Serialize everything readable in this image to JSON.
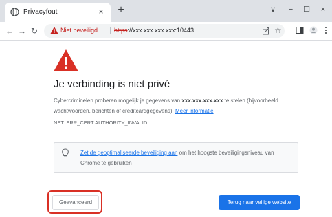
{
  "tab": {
    "title": "Privacyfout",
    "close_glyph": "×"
  },
  "newtab_glyph": "+",
  "window_controls": {
    "dropdown": "∨",
    "minimize": "−",
    "maximize": "☐",
    "close": "×"
  },
  "nav": {
    "back": "←",
    "forward": "→",
    "reload": "↻"
  },
  "address_bar": {
    "security_label": "Niet beveiligd",
    "url_scheme": "https",
    "url_rest": "://xxx.xxx.xxx.xxx:10443",
    "star_glyph": "☆"
  },
  "page": {
    "heading": "Je verbinding is niet privé",
    "description_pre": "Cybercriminelen proberen mogelijk je gegevens van ",
    "description_host": "xxx.xxx.xxx.xxx",
    "description_post": " te stelen (bijvoorbeeld wachtwoorden, berichten of creditcardgegevens). ",
    "more_info_link": "Meer informatie",
    "error_code": "NET::ERR_CERT AUTHORITY_INVALID",
    "safe_link": "Zet de geoptimaliseerde beveiliging aan",
    "safe_text": " om het hoogste beveiligingsniveau van Chrome te gebruiken",
    "advanced_button": "Geavanceerd",
    "back_button": "Terug naar veilige website"
  },
  "colors": {
    "accent": "#1a73e8",
    "danger": "#d93025",
    "highlight_box": "#d93025"
  }
}
